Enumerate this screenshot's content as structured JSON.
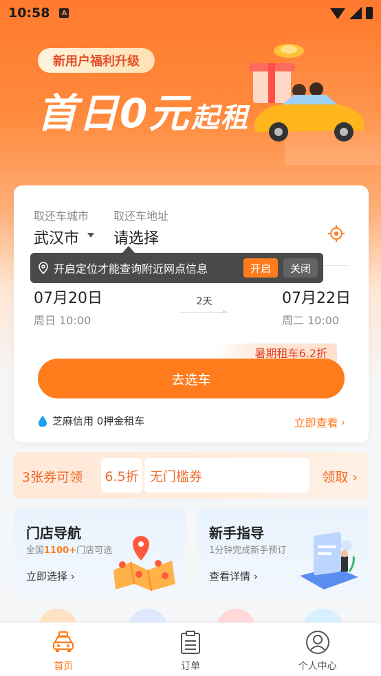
{
  "status_bar": {
    "time": "10:58",
    "indicator": "A"
  },
  "banner": {
    "badge": "新用户福利升级",
    "title_main": "首日0元",
    "title_sub": "起租"
  },
  "booking": {
    "city_label": "取还车城市",
    "city_value": "武汉市",
    "address_label": "取还车地址",
    "address_value": "请选择",
    "pickup_date": "07月20日",
    "pickup_time": "周日 10:00",
    "duration": "2天",
    "return_date": "07月22日",
    "return_time": "周二 10:00",
    "promo_tag": "暑期租车6.2折",
    "go_button": "去选车",
    "credit_text": "芝麻信用 0押金租车",
    "check_link": "立即查看"
  },
  "tooltip": {
    "text": "开启定位才能查询附近网点信息",
    "open_label": "开启",
    "close_label": "关闭"
  },
  "coupon": {
    "count": "3张券可领",
    "discount": "6.5折",
    "desc": "无门槛券",
    "claim": "领取"
  },
  "features": [
    {
      "title": "门店导航",
      "sub_prefix": "全国",
      "sub_highlight": "1100+",
      "sub_suffix": "门店可选",
      "link": "立即选择"
    },
    {
      "title": "新手指导",
      "sub": "1分钟完成新手预订",
      "link": "查看详情"
    }
  ],
  "tabs": [
    {
      "label": "首页",
      "icon": "car-icon",
      "active": true
    },
    {
      "label": "订单",
      "icon": "clipboard-icon",
      "active": false
    },
    {
      "label": "个人中心",
      "icon": "user-icon",
      "active": false
    }
  ],
  "colors": {
    "accent": "#ff7b1c",
    "coupon_text": "#f06a2a",
    "tooltip_bg": "#4a4a4a"
  }
}
